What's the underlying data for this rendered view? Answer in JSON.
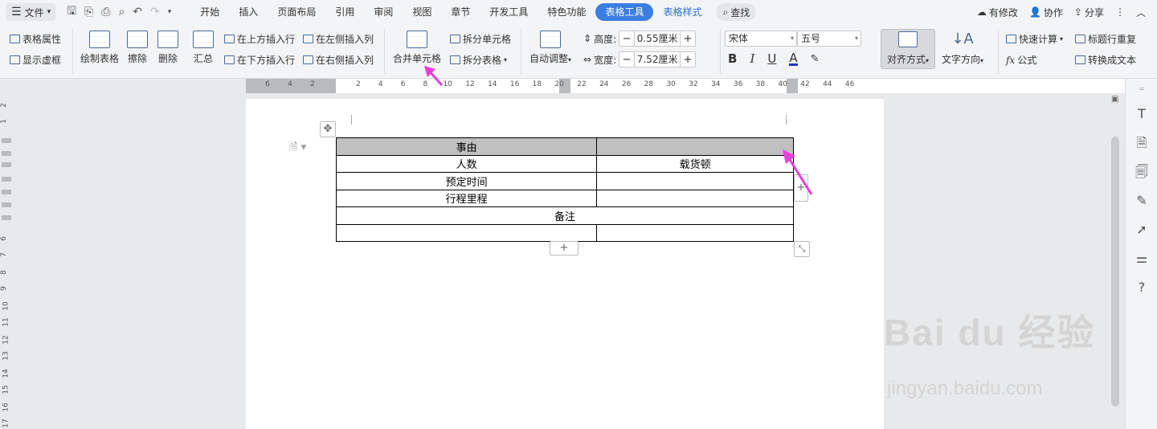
{
  "menubar": {
    "file_label": "文件",
    "tabs": [
      "开始",
      "插入",
      "页面布局",
      "引用",
      "审阅",
      "视图",
      "章节",
      "开发工具",
      "特色功能"
    ],
    "active_tab": "表格工具",
    "style_tab": "表格样式",
    "search_label": "查找",
    "has_changes": "有修改",
    "collab": "协作",
    "share": "分享"
  },
  "ribbon": {
    "table_props": "表格属性",
    "show_gridlines": "显示虚框",
    "draw_table": "绘制表格",
    "erase": "擦除",
    "delete": "删除",
    "summary": "汇总",
    "insert_above": "在上方插入行",
    "insert_below": "在下方插入行",
    "insert_left": "在左侧插入列",
    "insert_right": "在右侧插入列",
    "merge_cells": "合并单元格",
    "split_cells": "拆分单元格",
    "split_table": "拆分表格",
    "auto_fit": "自动调整",
    "height_label": "高度:",
    "height_value": "0.55厘米",
    "width_label": "宽度:",
    "width_value": "7.52厘米",
    "font_name": "宋体",
    "font_size": "五号",
    "bold": "B",
    "italic": "I",
    "underline": "U",
    "font_color": "A",
    "align": "对齐方式",
    "text_direction": "文字方向",
    "quick_calc": "快速计算",
    "repeat_header": "标题行重复",
    "formula": "公式",
    "to_text": "转换成文本"
  },
  "ruler": {
    "ticks": [
      "6",
      "4",
      "2",
      "2",
      "4",
      "6",
      "8",
      "10",
      "12",
      "14",
      "16",
      "18",
      "20",
      "22",
      "24",
      "26",
      "28",
      "30",
      "32",
      "34",
      "36",
      "38",
      "40",
      "42",
      "44",
      "46"
    ]
  },
  "vruler": {
    "ticks": [
      "2",
      "1",
      "6",
      "7",
      "8",
      "9",
      "10",
      "11",
      "12",
      "13",
      "14",
      "15",
      "16",
      "17"
    ]
  },
  "table": {
    "rows": [
      [
        "事由",
        ""
      ],
      [
        "人数",
        "载货顿"
      ],
      [
        "预定时间",
        ""
      ],
      [
        "行程里程",
        ""
      ],
      [
        "备注"
      ],
      [
        "",
        ""
      ]
    ]
  },
  "watermark": {
    "brand": "Bai du 经验",
    "url": "jingyan.baidu.com"
  },
  "colors": {
    "accent": "#3b7ee1",
    "arrow": "#e83ed8",
    "header_fill": "#c0c0c0"
  }
}
